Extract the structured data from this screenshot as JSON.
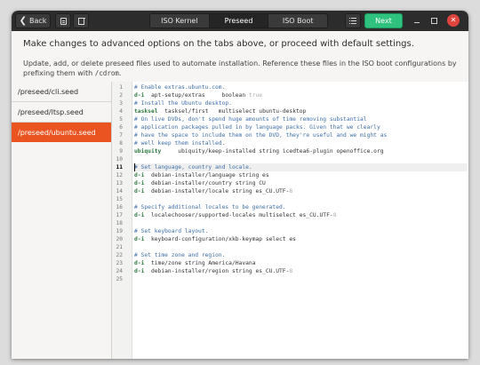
{
  "headerbar": {
    "back_label": "Back",
    "tabs": [
      {
        "label": "ISO Kernel",
        "active": false
      },
      {
        "label": "Preseed",
        "active": true
      },
      {
        "label": "ISO Boot",
        "active": false
      }
    ],
    "next_label": "Next",
    "next_color": "#2ec27e",
    "close_color": "#e0443e",
    "icons": [
      "chevron-left-icon",
      "document-icon",
      "trash-icon",
      "list-icon",
      "minimize-icon",
      "maximize-icon",
      "close-icon"
    ]
  },
  "main": {
    "subtitle": "Make changes to advanced options on the tabs above, or proceed with default settings.",
    "description": "Update, add, or delete preseed files used to automate installation. Reference these files in the ISO boot configurations by prefixing them with ",
    "description_code": "/cdrom",
    "description_end": "."
  },
  "sidebar": {
    "accent_color": "#e95420",
    "items": [
      {
        "label": "/preseed/cli.seed",
        "selected": false
      },
      {
        "label": "/preseed/ltsp.seed",
        "selected": false
      },
      {
        "label": "/preseed/ubuntu.seed",
        "selected": true
      }
    ]
  },
  "editor": {
    "current_line": 11,
    "lines": [
      {
        "n": "",
        "t": [
          [
            "cm",
            "# Enable extras.ubuntu.com."
          ]
        ]
      },
      {
        "n": "",
        "t": [
          [
            "kw",
            "d-i"
          ],
          [
            "",
            "  apt-setup/extras     boolean "
          ],
          [
            "gr",
            "true"
          ]
        ]
      },
      {
        "n": "",
        "t": [
          [
            "cm",
            "# Install the Ubuntu desktop."
          ]
        ]
      },
      {
        "n": "",
        "t": [
          [
            "kw",
            "tasksel"
          ],
          [
            "",
            "  tasksel/first   multiselect ubuntu-desktop"
          ]
        ]
      },
      {
        "n": "",
        "t": [
          [
            "cm",
            "# On live DVDs, don't spend huge amounts of time removing substantial"
          ]
        ]
      },
      {
        "n": "",
        "t": [
          [
            "cm",
            "# application packages pulled in by language packs. Given that we clearly"
          ]
        ]
      },
      {
        "n": "",
        "t": [
          [
            "cm",
            "# have the space to include them on the DVD, they're useful and we might as"
          ]
        ]
      },
      {
        "n": "",
        "t": [
          [
            "cm",
            "# well keep them installed."
          ]
        ]
      },
      {
        "n": "",
        "t": [
          [
            "kw",
            "ubiquity"
          ],
          [
            "",
            "     ubiquity/keep-installed string icedtea6-plugin openoffice.org"
          ]
        ]
      },
      {
        "n": "",
        "t": []
      },
      {
        "n": "11",
        "t": [
          [
            "cm",
            "# Set language, country and locale."
          ]
        ]
      },
      {
        "n": "12",
        "t": [
          [
            "kw",
            "d-i"
          ],
          [
            "",
            "  debian-installer/language string es"
          ]
        ]
      },
      {
        "n": "13",
        "t": [
          [
            "kw",
            "d-i"
          ],
          [
            "",
            "  debian-installer/country string CU"
          ]
        ]
      },
      {
        "n": "14",
        "t": [
          [
            "kw",
            "d-i"
          ],
          [
            "",
            "  debian-installer/locale string es_CU.UTF-"
          ],
          [
            "gr",
            "8"
          ]
        ]
      },
      {
        "n": "15",
        "t": []
      },
      {
        "n": "16",
        "t": [
          [
            "cm",
            "# Specify additional locales to be generated."
          ]
        ]
      },
      {
        "n": "17",
        "t": [
          [
            "kw",
            "d-i"
          ],
          [
            "",
            "  localechooser/supported-locales multiselect es_CU.UTF-"
          ],
          [
            "gr",
            "8"
          ]
        ]
      },
      {
        "n": "18",
        "t": []
      },
      {
        "n": "19",
        "t": [
          [
            "cm",
            "# Set keyboard layout."
          ]
        ]
      },
      {
        "n": "20",
        "t": [
          [
            "kw",
            "d-i"
          ],
          [
            "",
            "  keyboard-configuration/xkb-keymap select es"
          ]
        ]
      },
      {
        "n": "21",
        "t": []
      },
      {
        "n": "22",
        "t": [
          [
            "cm",
            "# Set time zone and region."
          ]
        ]
      },
      {
        "n": "23",
        "t": [
          [
            "kw",
            "d-i"
          ],
          [
            "",
            "  time/zone string America/Havana"
          ]
        ]
      },
      {
        "n": "24",
        "t": [
          [
            "kw",
            "d-i"
          ],
          [
            "",
            "  debian-installer/region string es_CU.UTF-"
          ],
          [
            "gr",
            "8"
          ]
        ]
      },
      {
        "n": "25",
        "t": []
      }
    ],
    "gutter_numbers": [
      "1",
      "2",
      "3",
      "4",
      "5",
      "6",
      "7",
      "8",
      "9",
      "10",
      "11",
      "12",
      "13",
      "14",
      "15",
      "16",
      "17",
      "18",
      "19",
      "20",
      "21",
      "22",
      "23",
      "24",
      "25"
    ]
  }
}
